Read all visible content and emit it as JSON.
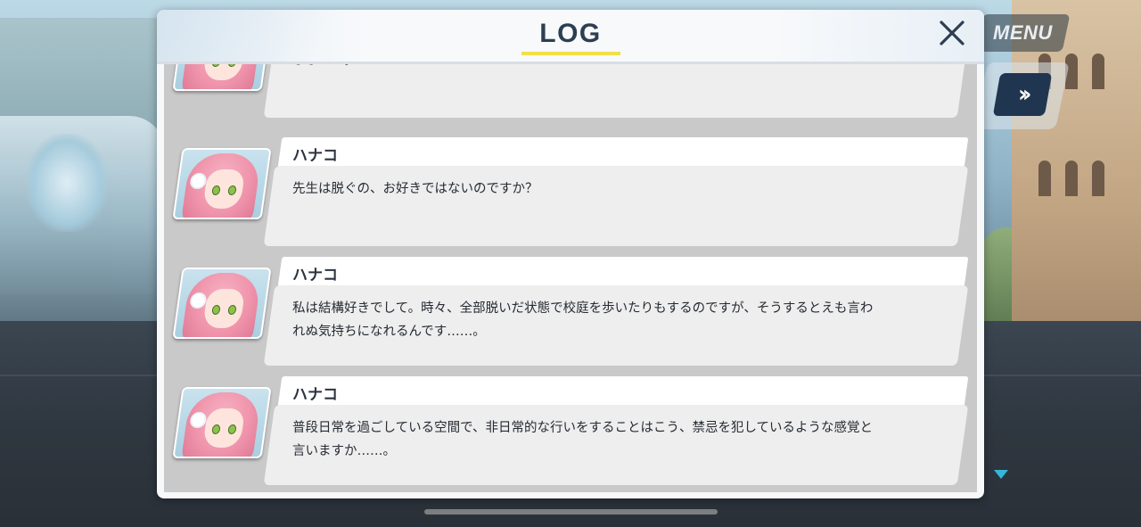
{
  "hud": {
    "menu_label": "MENU",
    "skip_icon": "fast-forward-icon"
  },
  "log": {
    "title": "LOG",
    "close_icon": "close-icon",
    "accent_color": "#f0e04a",
    "entries": [
      {
        "speaker": "",
        "text": "ふふ……。"
      },
      {
        "speaker": "ハナコ",
        "text": "先生は脱ぐの、お好きではないのですか？"
      },
      {
        "speaker": "ハナコ",
        "text": "私は結構好きでして。時々、全部脱いだ状態で校庭を歩いたりもするのですが、そうするとえも言われぬ気持ちになれるんです……。"
      },
      {
        "speaker": "ハナコ",
        "text": "普段日常を過ごしている空間で、非日常的な行いをすることはこう、禁忌を犯しているような感覚と言いますか……。"
      }
    ]
  }
}
